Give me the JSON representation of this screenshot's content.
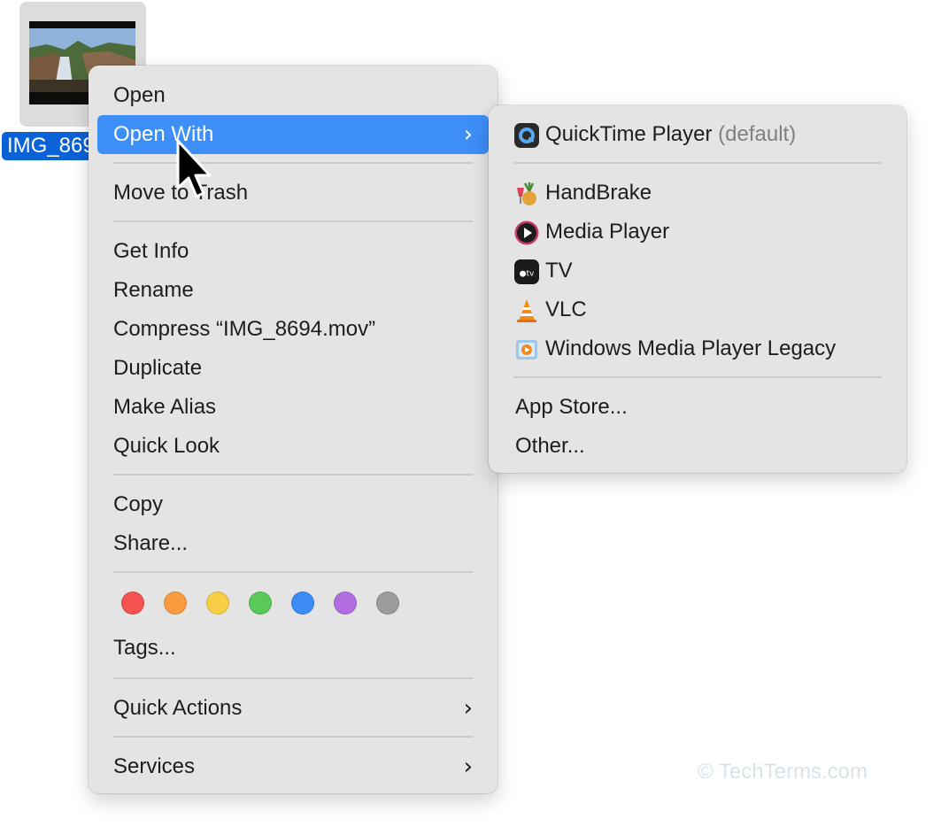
{
  "file": {
    "name": "IMG_8694.mov",
    "label": "IMG_8694.mov"
  },
  "context_menu": {
    "open": "Open",
    "open_with": "Open With",
    "move_to_trash": "Move to Trash",
    "get_info": "Get Info",
    "rename": "Rename",
    "compress": "Compress “IMG_8694.mov”",
    "duplicate": "Duplicate",
    "make_alias": "Make Alias",
    "quick_look": "Quick Look",
    "copy": "Copy",
    "share": "Share...",
    "tags": "Tags...",
    "quick_actions": "Quick Actions",
    "services": "Services",
    "tag_colors": [
      "#f65252",
      "#f99c40",
      "#f8cf44",
      "#5ac95a",
      "#3c8cf7",
      "#b26ee0",
      "#9c9c9c"
    ]
  },
  "open_with_menu": {
    "default_app": "QuickTime Player",
    "default_suffix": "(default)",
    "apps": [
      {
        "name": "HandBrake",
        "icon": "handbrake-icon"
      },
      {
        "name": "Media Player",
        "icon": "media-player-icon"
      },
      {
        "name": "TV",
        "icon": "apple-tv-icon"
      },
      {
        "name": "VLC",
        "icon": "vlc-cone-icon"
      },
      {
        "name": "Windows Media Player Legacy",
        "icon": "windows-media-player-icon"
      }
    ],
    "app_store": "App Store...",
    "other": "Other..."
  },
  "colors": {
    "highlight": "#3d8ef7",
    "selection_label": "#0a62d6",
    "menu_background": "#e4e4e4"
  },
  "watermark": "© TechTerms.com"
}
